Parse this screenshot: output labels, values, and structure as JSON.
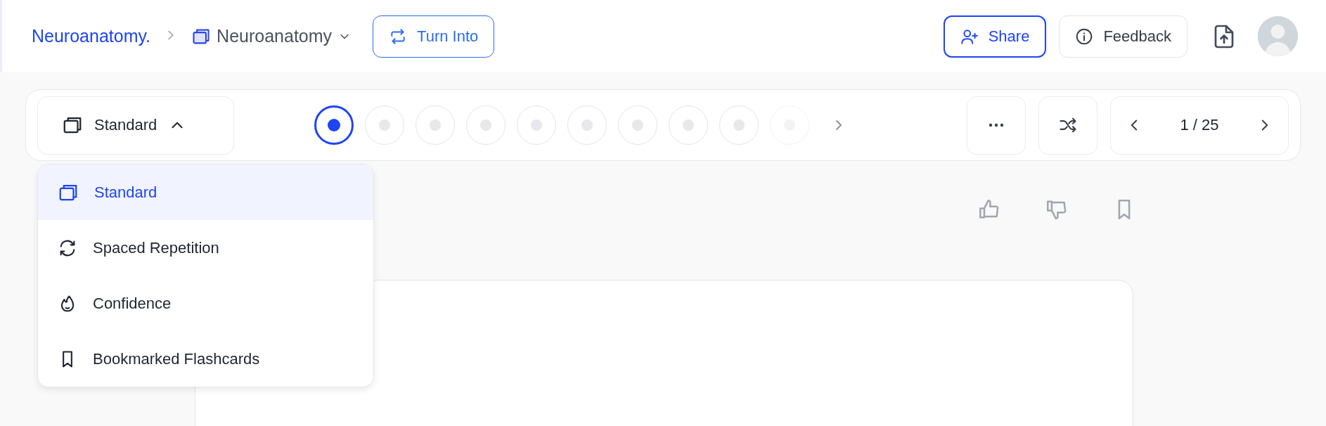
{
  "breadcrumb": {
    "root": "Neuroanatomy.",
    "current": "Neuroanatomy"
  },
  "header_buttons": {
    "turn_into": "Turn Into",
    "share": "Share",
    "feedback": "Feedback"
  },
  "mode_selector": {
    "label": "Standard",
    "expanded": true
  },
  "steps": [
    {
      "selected": true
    },
    {
      "selected": false
    },
    {
      "selected": false
    },
    {
      "selected": false
    },
    {
      "selected": false
    },
    {
      "selected": false
    },
    {
      "selected": false
    },
    {
      "selected": false
    },
    {
      "selected": false
    },
    {
      "selected": false
    }
  ],
  "pager": {
    "counter": "1 / 25"
  },
  "mode_menu": [
    {
      "kind": "standard",
      "label": "Standard",
      "selected": true
    },
    {
      "kind": "spaced",
      "label": "Spaced Repetition",
      "selected": false
    },
    {
      "kind": "confidence",
      "label": "Confidence",
      "selected": false
    },
    {
      "kind": "bookmarked",
      "label": "Bookmarked Flashcards",
      "selected": false
    }
  ]
}
